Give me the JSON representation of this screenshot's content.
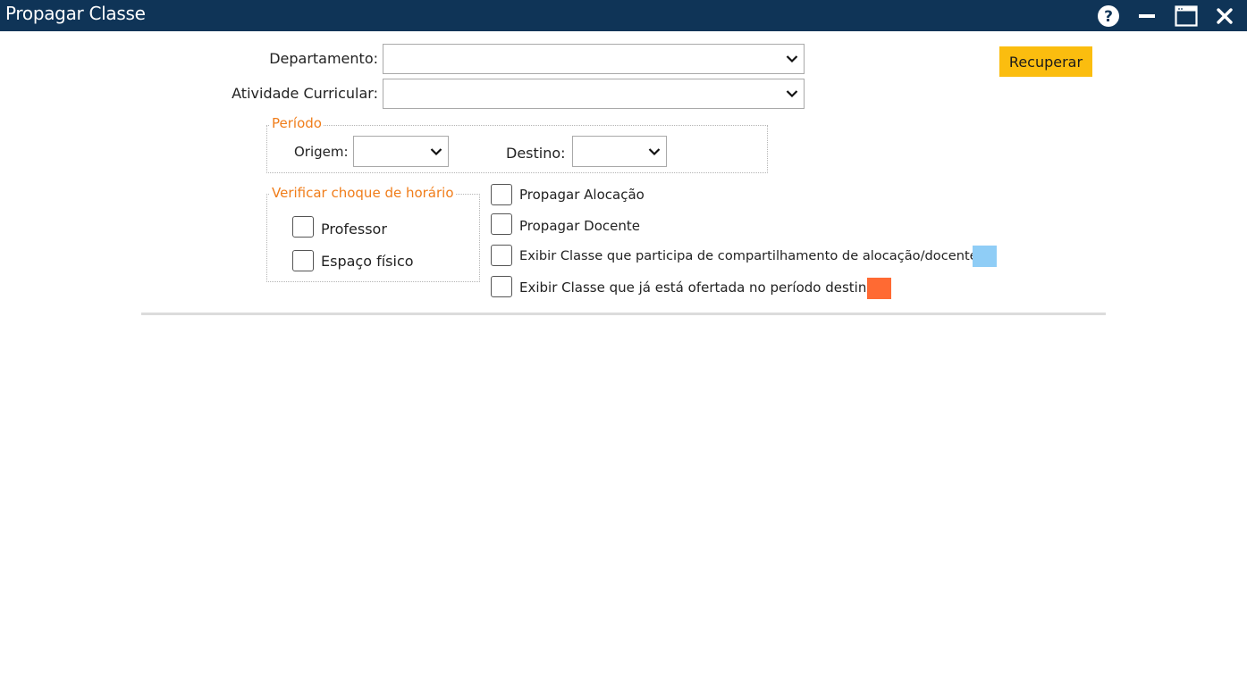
{
  "window": {
    "title": "Propagar Classe",
    "controls": {
      "help": "?",
      "minimize": "minimize",
      "maximize": "maximize",
      "close": "close"
    }
  },
  "form": {
    "departamento_label": "Departamento:",
    "departamento_value": "",
    "atividade_label": "Atividade Curricular:",
    "atividade_value": "",
    "recuperar_label": "Recuperar"
  },
  "periodo": {
    "legend": "Período",
    "origem_label": "Origem:",
    "origem_value": "",
    "destino_label": "Destino:",
    "destino_value": ""
  },
  "choque": {
    "legend": "Verificar choque de horário",
    "professor_label": "Professor",
    "professor_checked": false,
    "espaco_label": "Espaço físico",
    "espaco_checked": false
  },
  "options": {
    "propagar_alocacao_label": "Propagar Alocação",
    "propagar_alocacao_checked": false,
    "propagar_docente_label": "Propagar Docente",
    "propagar_docente_checked": false,
    "exibir_compartilhamento_label": "Exibir Classe que participa de compartilhamento de alocação/docente",
    "exibir_compartilhamento_checked": false,
    "exibir_compartilhamento_color": "#8fcdf6",
    "exibir_ofertada_label": "Exibir Classe que já está ofertada no período destino",
    "exibir_ofertada_checked": false,
    "exibir_ofertada_color": "#ff6a33"
  },
  "colors": {
    "titlebar": "#0f3457",
    "accent_button": "#fbbd0f",
    "legend_text": "#f07d1a"
  }
}
